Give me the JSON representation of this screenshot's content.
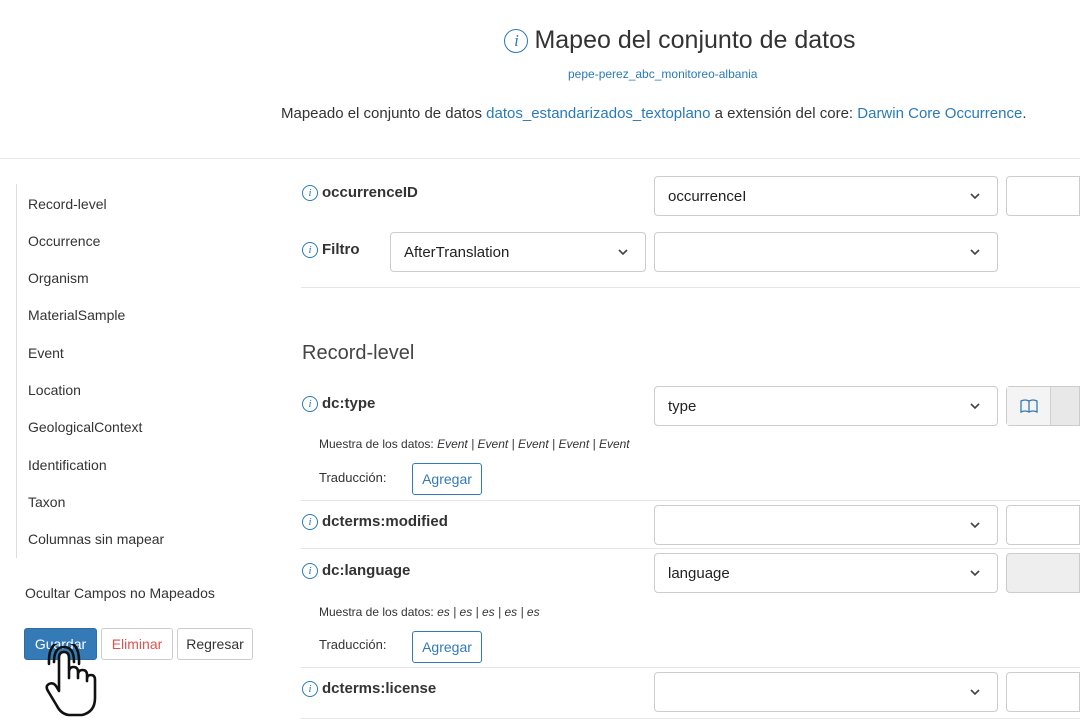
{
  "header": {
    "title": "Mapeo del conjunto de datos",
    "subtitle": "pepe-perez_abc_monitoreo-albania",
    "mapping_prefix": "Mapeado el conjunto de datos ",
    "dataset_link": "datos_estandarizados_textoplano",
    "mapping_middle": " a extensión del core: ",
    "core_link": "Darwin Core Occurrence",
    "mapping_suffix": "."
  },
  "sidebar": {
    "items": [
      {
        "label": "Record-level"
      },
      {
        "label": "Occurrence"
      },
      {
        "label": "Organism"
      },
      {
        "label": "MaterialSample"
      },
      {
        "label": "Event"
      },
      {
        "label": "Location"
      },
      {
        "label": "GeologicalContext"
      },
      {
        "label": "Identification"
      },
      {
        "label": "Taxon"
      },
      {
        "label": "Columnas sin mapear"
      }
    ],
    "hide_unmapped": "Ocultar Campos no Mapeados",
    "save_label": "Guardar",
    "delete_label": "Eliminar",
    "back_label": "Regresar"
  },
  "main": {
    "occurrence_id": {
      "label": "occurrenceID",
      "value": "occurrenceI"
    },
    "filter": {
      "label": "Filtro",
      "type_value": "AfterTranslation",
      "value": ""
    },
    "section_title": "Record-level",
    "sample_prefix": "Muestra de los datos: ",
    "translation_label": "Traducción:",
    "add_label": "Agregar",
    "fields": [
      {
        "label": "dc:type",
        "value": "type",
        "sample": "Event | Event | Event | Event | Event"
      },
      {
        "label": "dcterms:modified",
        "value": ""
      },
      {
        "label": "dc:language",
        "value": "language",
        "sample": "es | es | es | es | es"
      },
      {
        "label": "dcterms:license",
        "value": ""
      }
    ]
  },
  "colors": {
    "accent": "#337ab7",
    "link": "#2a7ab8",
    "danger": "#d9534f"
  }
}
